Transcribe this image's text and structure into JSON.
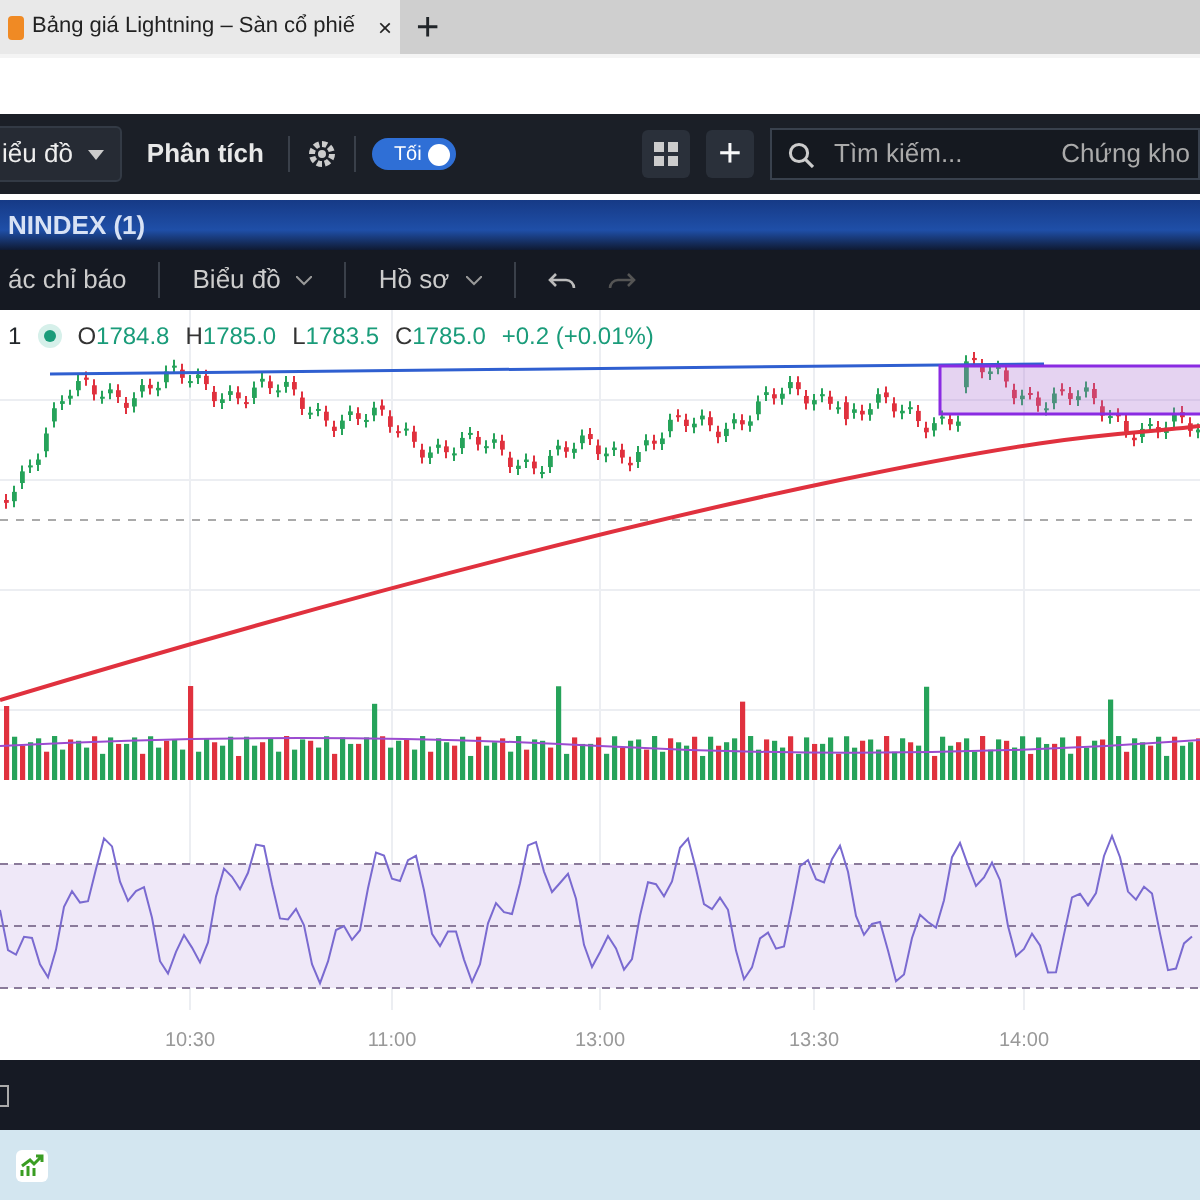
{
  "browser_tab": {
    "title": "Bảng giá Lightning – Sàn cổ phiế",
    "close": "×",
    "new_tab": "+"
  },
  "toolbar": {
    "chart_menu": "iểu đồ",
    "analysis": "Phân tích",
    "theme_toggle": {
      "label": "Tối",
      "on": true
    },
    "add": "+",
    "search": {
      "placeholder": "Tìm kiếm..."
    },
    "market": "Chứng kho"
  },
  "chart_header": {
    "title": "NINDEX (1)"
  },
  "chart_toolbar": [
    "ác chỉ báo",
    "Biểu đồ",
    "Hồ sơ"
  ],
  "legend": {
    "interval": "1",
    "ohlc": [
      {
        "label": "O",
        "value": "1784.8"
      },
      {
        "label": "H",
        "value": "1785.0"
      },
      {
        "label": "L",
        "value": "1783.5"
      },
      {
        "label": "C",
        "value": "1785.0"
      }
    ],
    "change": "+0.2 (+0.01%)"
  },
  "x_axis": [
    "10:30",
    "11:00",
    "13:00",
    "13:30",
    "14:00"
  ]
}
